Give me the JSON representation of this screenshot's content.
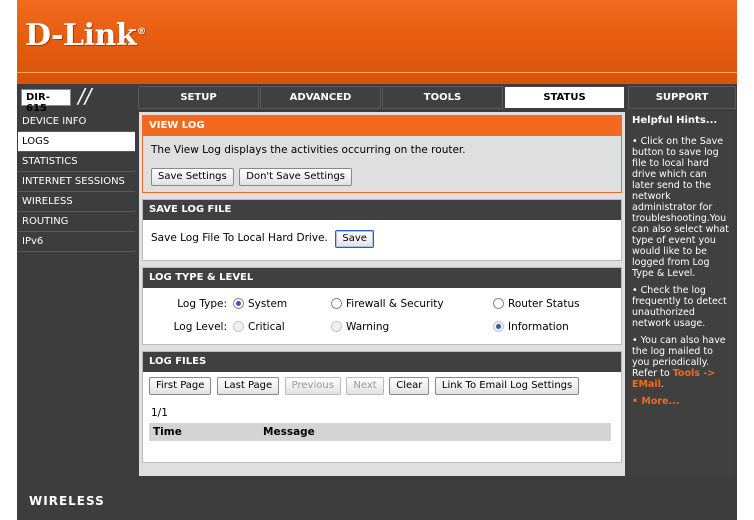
{
  "brand": {
    "logo": "D-Link",
    "reg": "®"
  },
  "model": {
    "name": "DIR-615",
    "slashes": "//"
  },
  "tabs": [
    {
      "label": "SETUP"
    },
    {
      "label": "ADVANCED"
    },
    {
      "label": "TOOLS"
    },
    {
      "label": "STATUS"
    },
    {
      "label": "SUPPORT"
    }
  ],
  "leftnav": [
    {
      "label": "DEVICE INFO"
    },
    {
      "label": "LOGS"
    },
    {
      "label": "STATISTICS"
    },
    {
      "label": "INTERNET SESSIONS"
    },
    {
      "label": "WIRELESS"
    },
    {
      "label": "ROUTING"
    },
    {
      "label": "IPv6"
    }
  ],
  "viewlog": {
    "title": "VIEW LOG",
    "description": "The View Log displays the activities occurring on the router.",
    "save_settings": "Save Settings",
    "dont_save": "Don't Save Settings"
  },
  "savelog": {
    "title": "SAVE LOG FILE",
    "text": "Save Log File To Local Hard Drive.",
    "save_button": "Save"
  },
  "logtype": {
    "title": "LOG TYPE & LEVEL",
    "type_label": "Log Type:",
    "level_label": "Log Level:",
    "type_options": [
      "System",
      "Firewall & Security",
      "Router Status"
    ],
    "type_selected": "System",
    "level_options": [
      "Critical",
      "Warning",
      "Information"
    ],
    "level_selected": "Information"
  },
  "logfiles": {
    "title": "LOG FILES",
    "buttons": [
      "First Page",
      "Last Page",
      "Previous",
      "Next",
      "Clear",
      "Link To Email Log Settings"
    ],
    "page": "1/1",
    "col_time": "Time",
    "col_message": "Message"
  },
  "hints": {
    "title": "Helpful Hints...",
    "hint1": "• Click on the Save button to save log file to local hard drive which can later send to the network administrator for troubleshooting.You can also select what type of event you would like to be logged from Log Type & Level.",
    "hint2": "• Check the log frequently to detect unauthorized network usage.",
    "hint3": "• You can also have the log mailed to you periodically. Refer to",
    "hint3_link": "Tools -> EMail",
    "hint3_end": ".",
    "more": "• More..."
  },
  "footer": {
    "brand": "WIRELESS"
  }
}
